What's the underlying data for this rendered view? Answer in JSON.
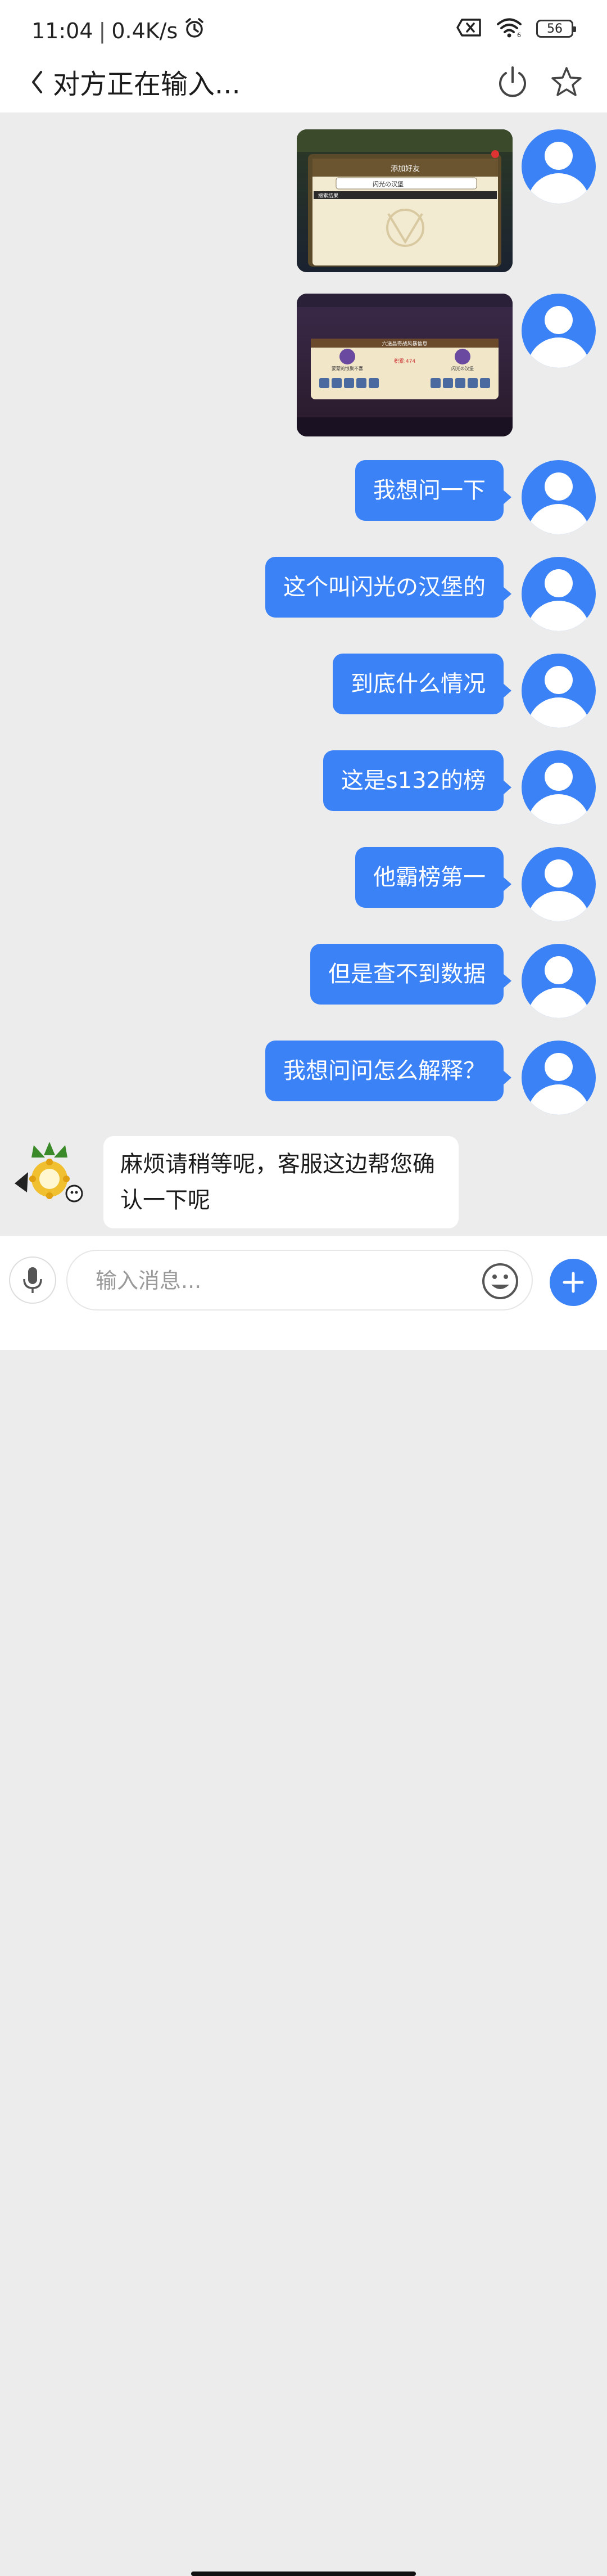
{
  "status": {
    "time": "11:04",
    "net_speed": "0.4K/s",
    "battery_level": "56"
  },
  "header": {
    "title": "对方正在输入..."
  },
  "images": {
    "first": {
      "caption_title": "添加好友",
      "search_text": "闪光の汉堡",
      "result_label": "搜索结果"
    },
    "second": {
      "title": "六送昌奇战风暴信息",
      "left_name": "蒙蒙的惊聚不喜",
      "right_name": "闪光の汉堡",
      "score": "积累:474"
    }
  },
  "messages": [
    {
      "text": "我想问一下"
    },
    {
      "text": "这个叫闪光の汉堡的"
    },
    {
      "text": "到底什么情况"
    },
    {
      "text": "这是s132的榜"
    },
    {
      "text": "他霸榜第一"
    },
    {
      "text": "但是查不到数据"
    },
    {
      "text": "我想问问怎么解释？"
    }
  ],
  "agent": {
    "text": "麻烦请稍等呢，客服这边帮您确认一下呢"
  },
  "input": {
    "placeholder": "输入消息..."
  },
  "colors": {
    "accent": "#3b82f6",
    "background": "#ececec"
  }
}
